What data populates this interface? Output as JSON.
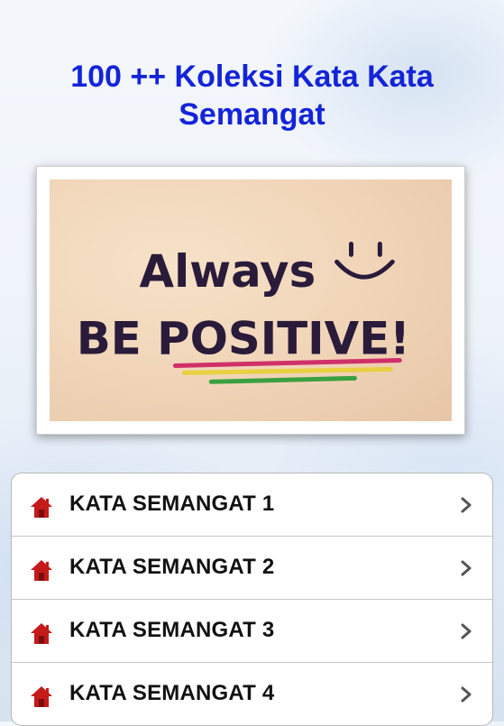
{
  "header": {
    "title_line1": "100 ++ Koleksi Kata Kata",
    "title_line2": "Semangat"
  },
  "image": {
    "line1": "Always",
    "line2": "BE POSITIVE!"
  },
  "menu": {
    "items": [
      {
        "label": "KATA SEMANGAT 1",
        "icon": "home-icon"
      },
      {
        "label": "KATA SEMANGAT 2",
        "icon": "home-icon"
      },
      {
        "label": "KATA SEMANGAT 3",
        "icon": "home-icon"
      },
      {
        "label": "KATA SEMANGAT 4",
        "icon": "home-icon"
      }
    ]
  },
  "colors": {
    "title": "#1424d8",
    "home_icon": "#c41a1a",
    "chevron": "#555555"
  }
}
